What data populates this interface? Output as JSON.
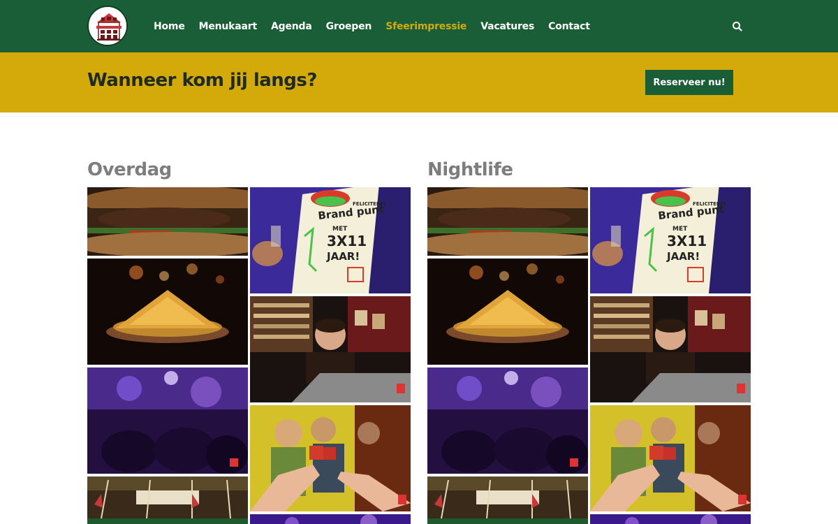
{
  "header": {
    "logo_alt": "Brand punt",
    "nav": [
      {
        "label": "Home",
        "active": false
      },
      {
        "label": "Menukaart",
        "active": false
      },
      {
        "label": "Agenda",
        "active": false
      },
      {
        "label": "Groepen",
        "active": false
      },
      {
        "label": "Sfeerimpressie",
        "active": true
      },
      {
        "label": "Vacatures",
        "active": false
      },
      {
        "label": "Contact",
        "active": false
      }
    ],
    "search_icon": "search-icon"
  },
  "cta": {
    "title": "Wanneer kom jij langs?",
    "button_label": "Reserveer nu!"
  },
  "galleries": [
    {
      "title": "Overdag"
    },
    {
      "title": "Nightlife"
    }
  ],
  "poster": {
    "line1": "FELICITEERT",
    "line2": "Brand punt",
    "line3": "MET",
    "line4": "3X11",
    "line5": "JAAR!"
  },
  "colors": {
    "header_green": "#1a5e37",
    "accent_yellow": "#d4aa0a",
    "section_title_gray": "#7d7d7d"
  }
}
